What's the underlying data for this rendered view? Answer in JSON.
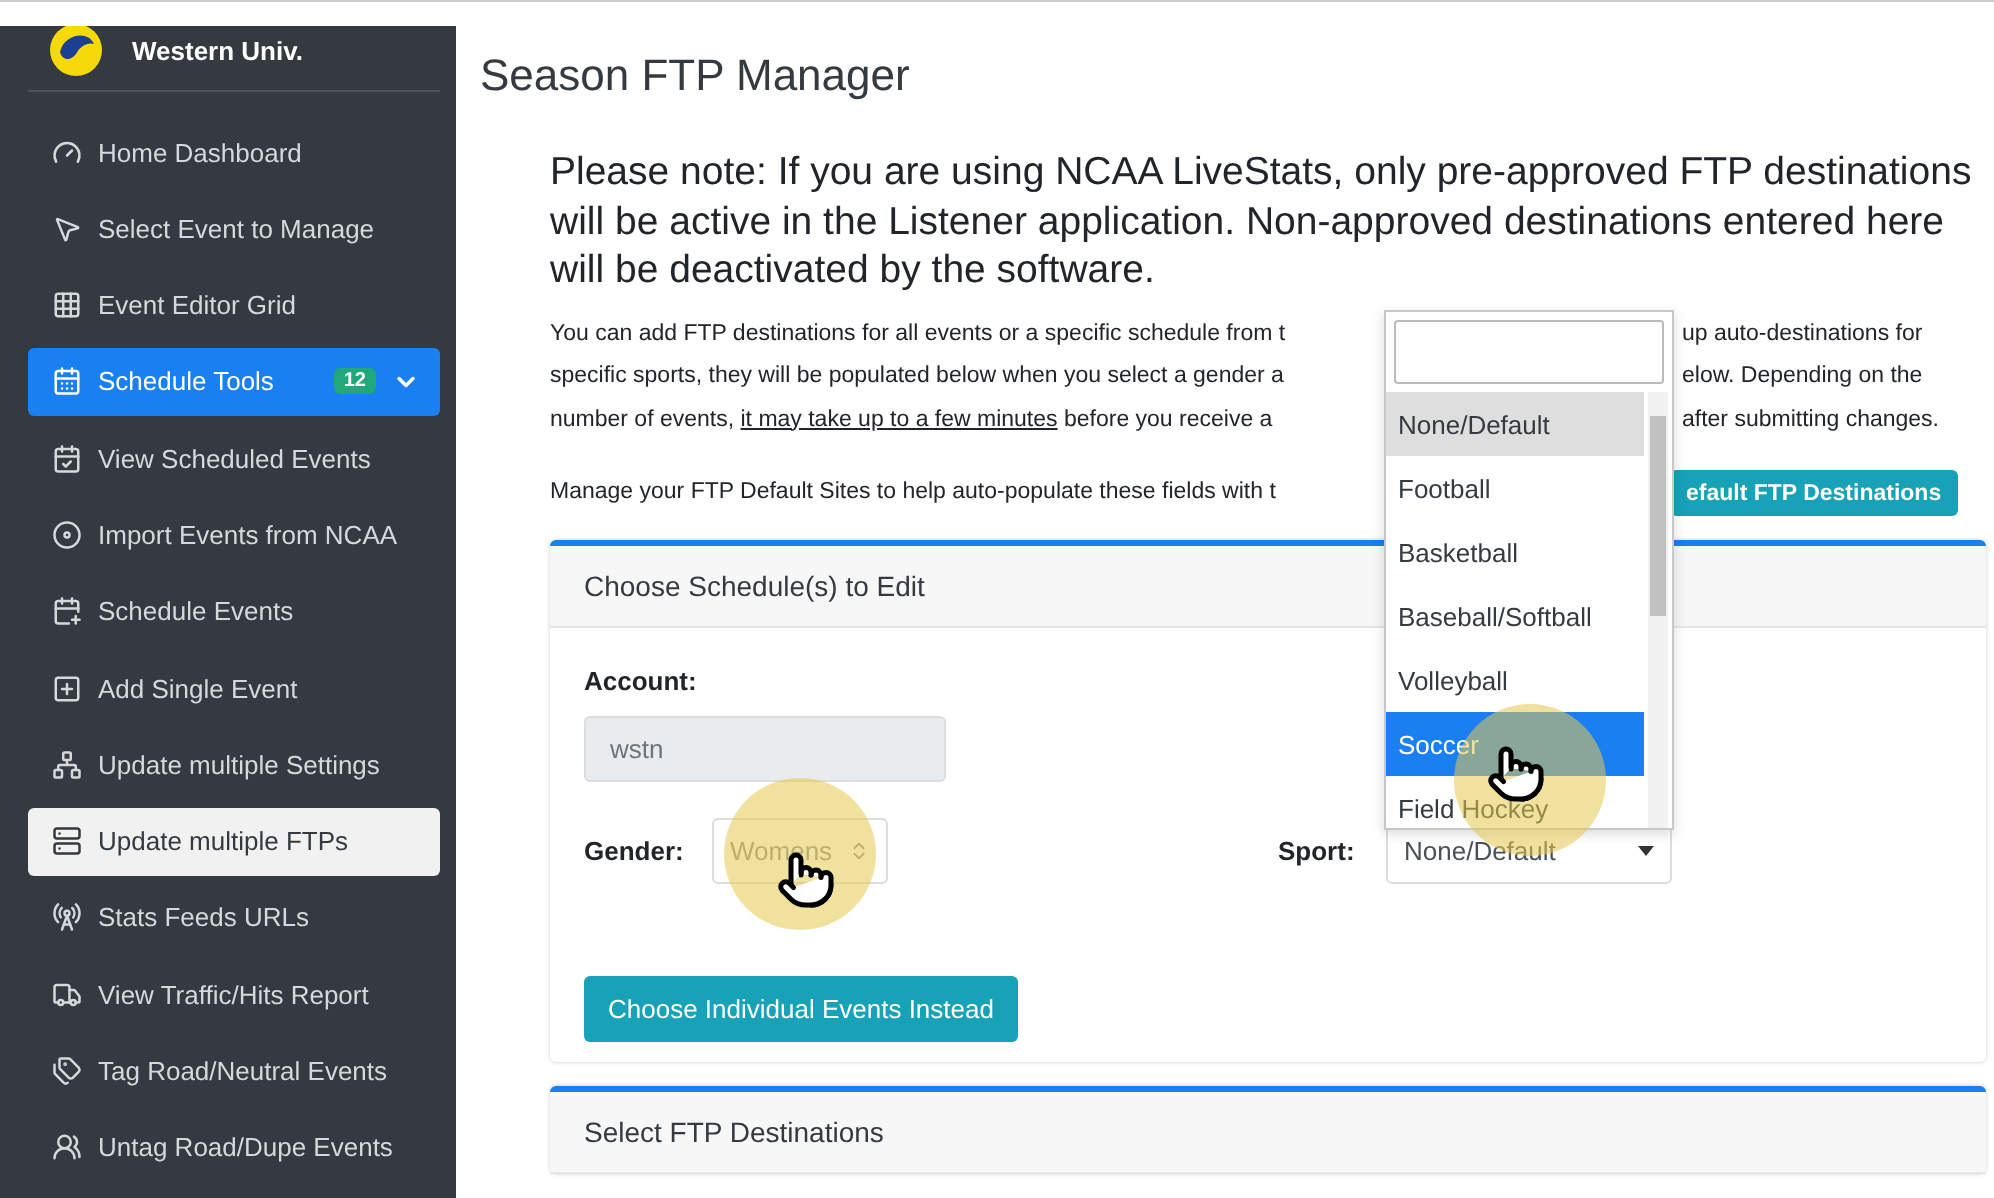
{
  "sidebar": {
    "brand": "Western Univ.",
    "items": [
      {
        "label": "Home Dashboard",
        "selected": false
      },
      {
        "label": "Select Event to Manage",
        "selected": false
      },
      {
        "label": "Event Editor Grid",
        "selected": false
      },
      {
        "label": "Schedule Tools",
        "selected": true,
        "badge": "12",
        "expanded": true,
        "children": [
          {
            "label": "View Scheduled Events",
            "selected": false
          },
          {
            "label": "Import Events from NCAA",
            "selected": false
          },
          {
            "label": "Schedule Events",
            "selected": false
          },
          {
            "label": "Add Single Event",
            "selected": false
          },
          {
            "label": "Update multiple Settings",
            "selected": false
          },
          {
            "label": "Update multiple FTPs",
            "selected": true
          },
          {
            "label": "Stats Feeds URLs",
            "selected": false
          },
          {
            "label": "View Traffic/Hits Report",
            "selected": false
          },
          {
            "label": "Tag Road/Neutral Events",
            "selected": false
          },
          {
            "label": "Untag Road/Dupe Events",
            "selected": false
          }
        ]
      }
    ]
  },
  "page": {
    "title": "Season FTP Manager",
    "notice": "Please note: If you are using NCAA LiveStats, only pre-approved FTP destinations will be active in the Listener application. Non-approved destinations entered here will be deactivated by the software.",
    "info_lines": [
      {
        "left": "You can add FTP destinations for all events or a specific schedule from t",
        "right": "up auto-destinations for"
      },
      {
        "left": "specific sports, they will be populated below when you select a gender a",
        "right": "elow. Depending on the"
      },
      {
        "left_before": "number of events, ",
        "link": "it may take up to a few minutes",
        "left_after": " before you receive a",
        "right": "after submitting changes."
      }
    ],
    "manage_line": "Manage your FTP Default Sites to help auto-populate these fields with t",
    "manage_button": "efault FTP Destinations"
  },
  "schedule_card": {
    "header": "Choose Schedule(s) to Edit",
    "account_label": "Account:",
    "account_value": "wstn",
    "gender_label": "Gender:",
    "gender_value": "Womens",
    "sport_label": "Sport:",
    "sport_value": "None/Default",
    "sport_dropdown": {
      "expanded": true,
      "options": [
        {
          "label": "None/Default",
          "selected": true,
          "highlighted": false
        },
        {
          "label": "Football",
          "selected": false,
          "highlighted": false
        },
        {
          "label": "Basketball",
          "selected": false,
          "highlighted": false
        },
        {
          "label": "Baseball/Softball",
          "selected": false,
          "highlighted": false
        },
        {
          "label": "Volleyball",
          "selected": false,
          "highlighted": false
        },
        {
          "label": "Soccer",
          "selected": false,
          "highlighted": true
        },
        {
          "label": "Field Hockey",
          "selected": false,
          "highlighted": false
        }
      ]
    },
    "button": "Choose Individual Events Instead"
  },
  "destinations_card": {
    "header": "Select FTP Destinations"
  }
}
